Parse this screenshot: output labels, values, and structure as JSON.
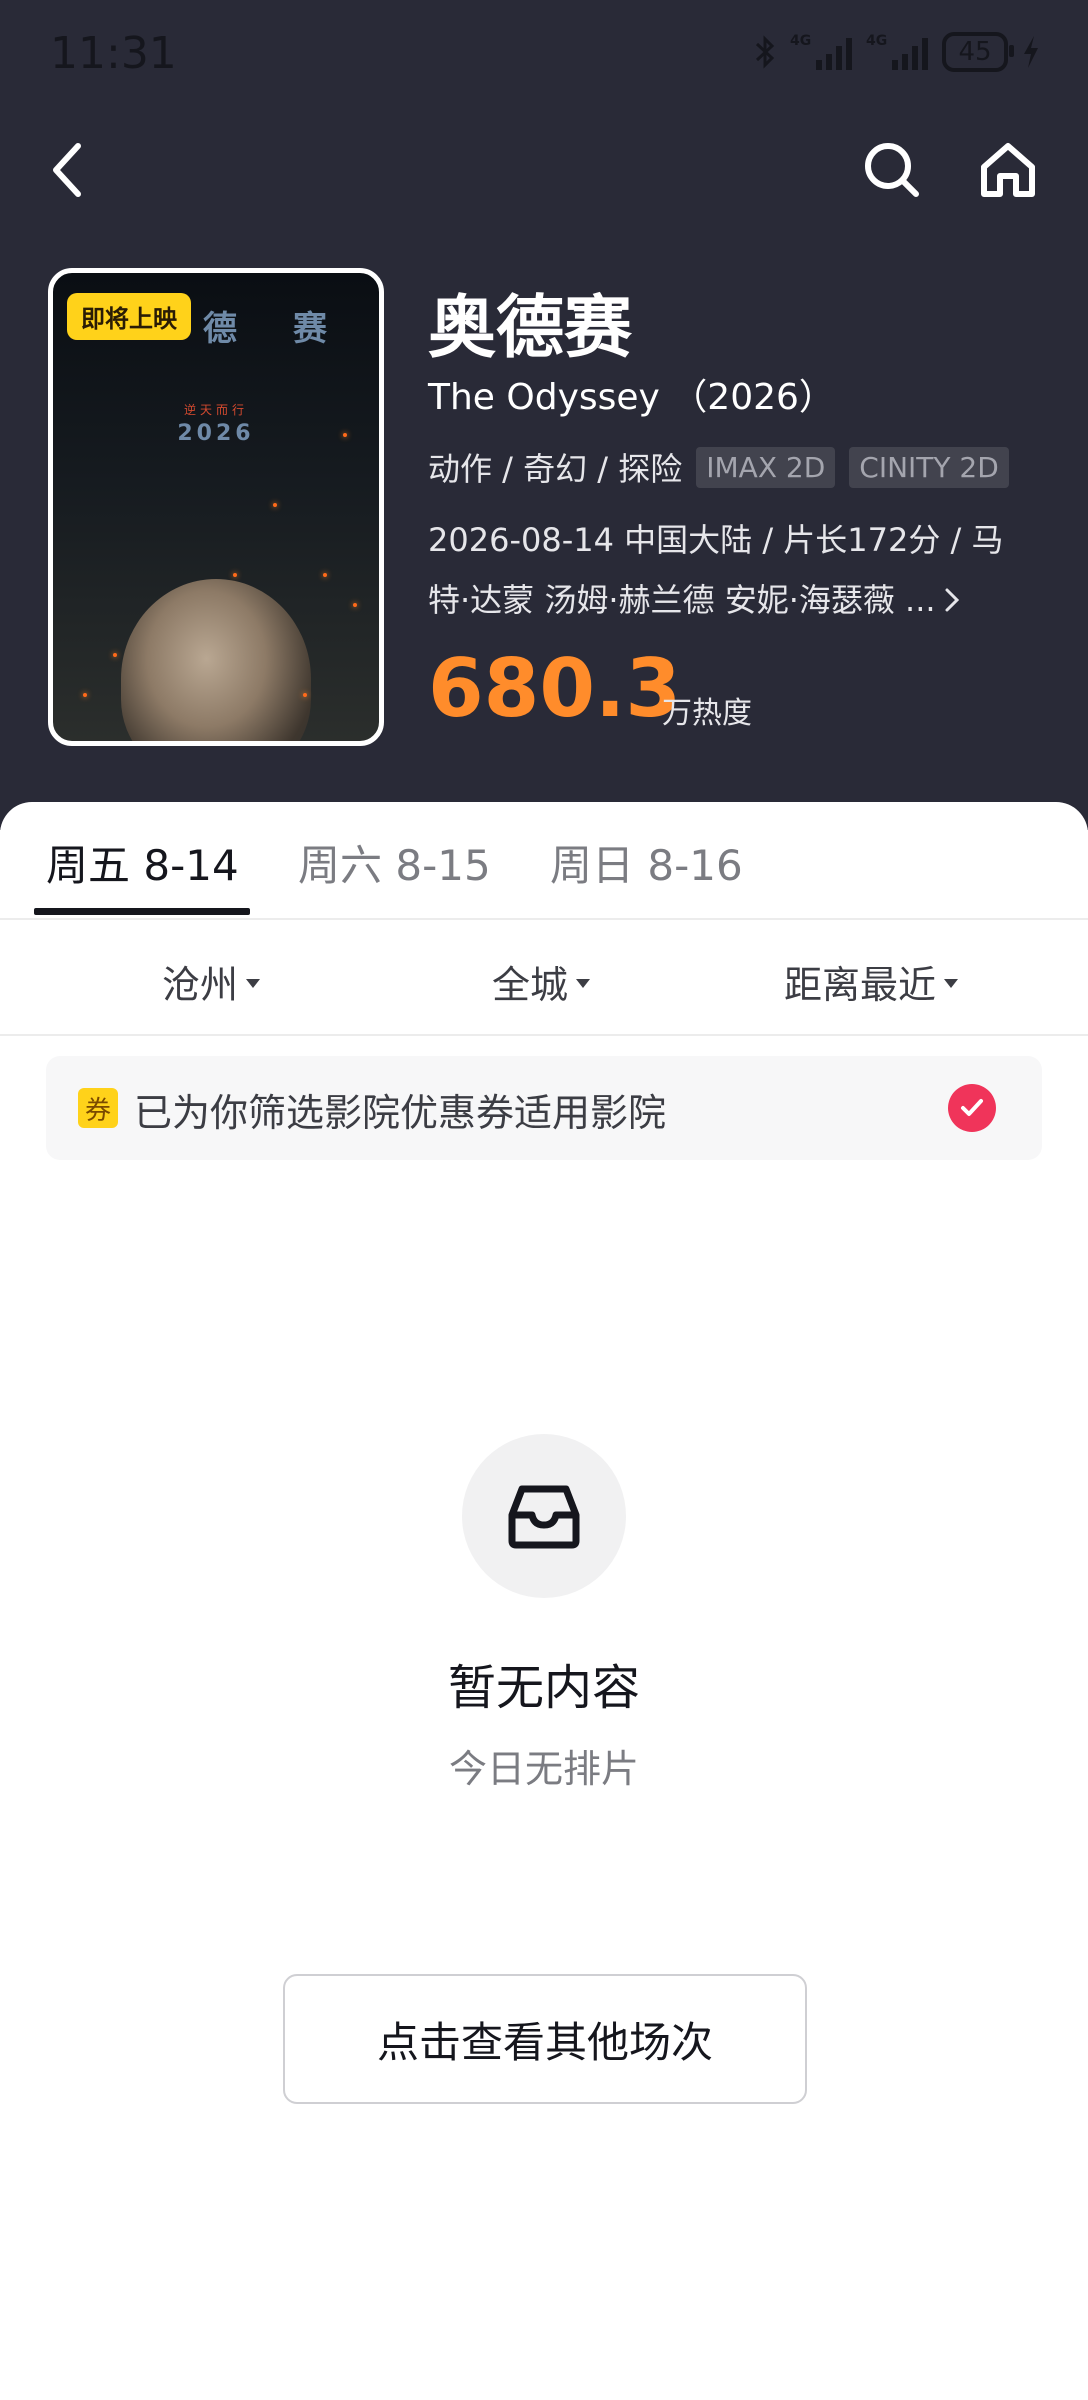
{
  "status_bar": {
    "time": "11:31",
    "network_1": "4G",
    "network_2": "4G",
    "battery": "45"
  },
  "nav": {
    "back_icon": "chevron-left-icon",
    "search_icon": "search-icon",
    "home_icon": "home-icon"
  },
  "movie": {
    "badge": "即将上映",
    "poster_chars": [
      "德",
      "赛"
    ],
    "poster_sub": "逆天而行",
    "poster_year": "2026",
    "title_zh": "奥德赛",
    "title_en": "The Odyssey （2026）",
    "genres": "动作 / 奇幻 / 探险",
    "formats": [
      "IMAX 2D",
      "CINITY 2D"
    ],
    "desc_line1": "2026-08-14 中国大陆 / 片长172分 / 马",
    "desc_line2": "特·达蒙 汤姆·赫兰德 安妮·海瑟薇 ...",
    "heat_value": "680.3",
    "heat_unit": "万热度"
  },
  "tabs": [
    {
      "label": "周五 8-14",
      "active": true
    },
    {
      "label": "周六 8-15",
      "active": false
    },
    {
      "label": "周日 8-16",
      "active": false
    }
  ],
  "filters": {
    "city": "沧州",
    "area": "全城",
    "sort": "距离最近"
  },
  "coupon": {
    "tag": "券",
    "text": "已为你筛选影院优惠券适用影院",
    "checked": true
  },
  "empty": {
    "icon": "inbox-icon",
    "title": "暂无内容",
    "subtitle": "今日无排片",
    "button_label": "点击查看其他场次"
  },
  "colors": {
    "header_bg": "#292a37",
    "heat": "#ff8c2b",
    "check": "#f0345a",
    "badge": "#ffd21a"
  }
}
